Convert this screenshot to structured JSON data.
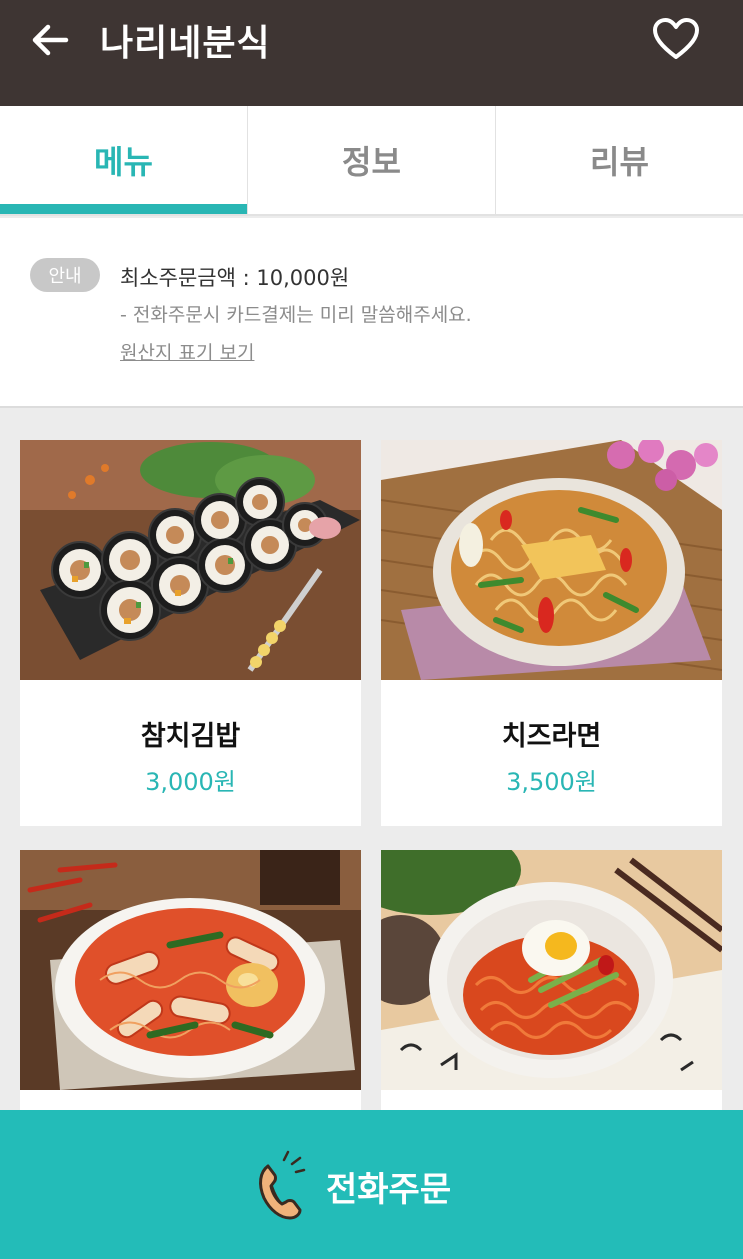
{
  "header": {
    "title": "나리네분식",
    "back_icon": "arrow-left-icon",
    "favorite_icon": "heart-outline-icon"
  },
  "tabs": [
    {
      "label": "메뉴",
      "active": true
    },
    {
      "label": "정보",
      "active": false
    },
    {
      "label": "리뷰",
      "active": false
    }
  ],
  "notice": {
    "badge": "안내",
    "min_order": "최소주문금액 : 10,000원",
    "card_note": "- 전화주문시 카드결제는 미리 말씀해주세요.",
    "origin_link": "원산지 표기 보기"
  },
  "menu_items": [
    {
      "name": "참치김밥",
      "price": "3,000원",
      "photo": "tuna-kimbap-photo"
    },
    {
      "name": "치즈라면",
      "price": "3,500원",
      "photo": "cheese-ramen-photo"
    },
    {
      "name": "",
      "price": "",
      "photo": "rabokki-photo"
    },
    {
      "name": "",
      "price": "",
      "photo": "bibim-noodles-photo"
    }
  ],
  "call_bar": {
    "label": "전화주문",
    "icon": "phone-icon"
  },
  "colors": {
    "header_bg": "#3e3533",
    "accent": "#29b6b4",
    "call_bar_bg": "#23bcb8"
  }
}
